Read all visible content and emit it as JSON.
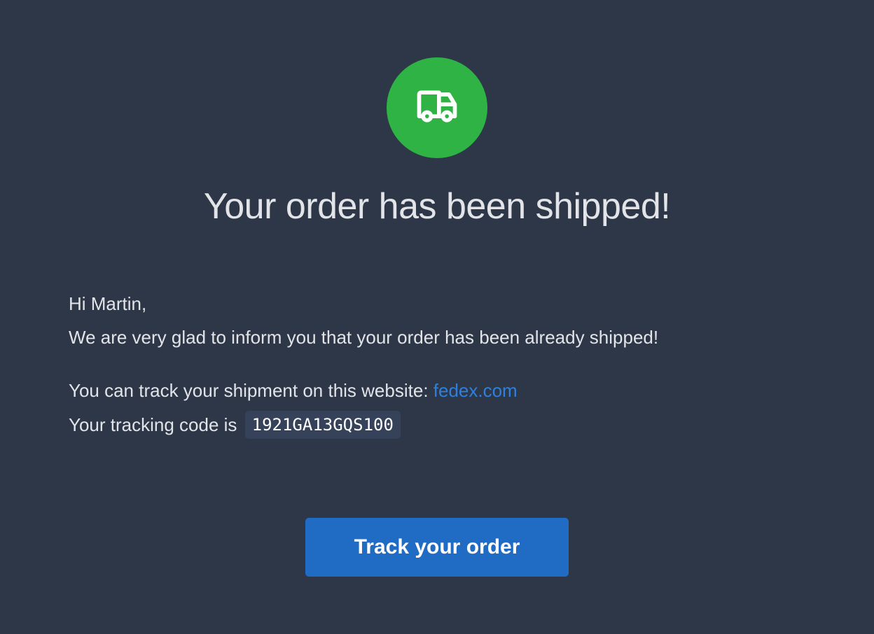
{
  "header": {
    "icon": "truck-icon",
    "icon_bg_color": "#2fb344",
    "title": "Your order has been shipped!"
  },
  "message": {
    "greeting": "Hi Martin,",
    "info": "We are very glad to inform you that your order has been already shipped!",
    "track_prefix": "You can track your shipment on this website: ",
    "track_link": "fedex.com",
    "code_prefix": "Your tracking code is ",
    "tracking_code": "1921GA13GQS100"
  },
  "cta": {
    "label": "Track your order",
    "color": "#206bc4"
  },
  "colors": {
    "background": "#2d3748",
    "link": "#2e80dd"
  }
}
